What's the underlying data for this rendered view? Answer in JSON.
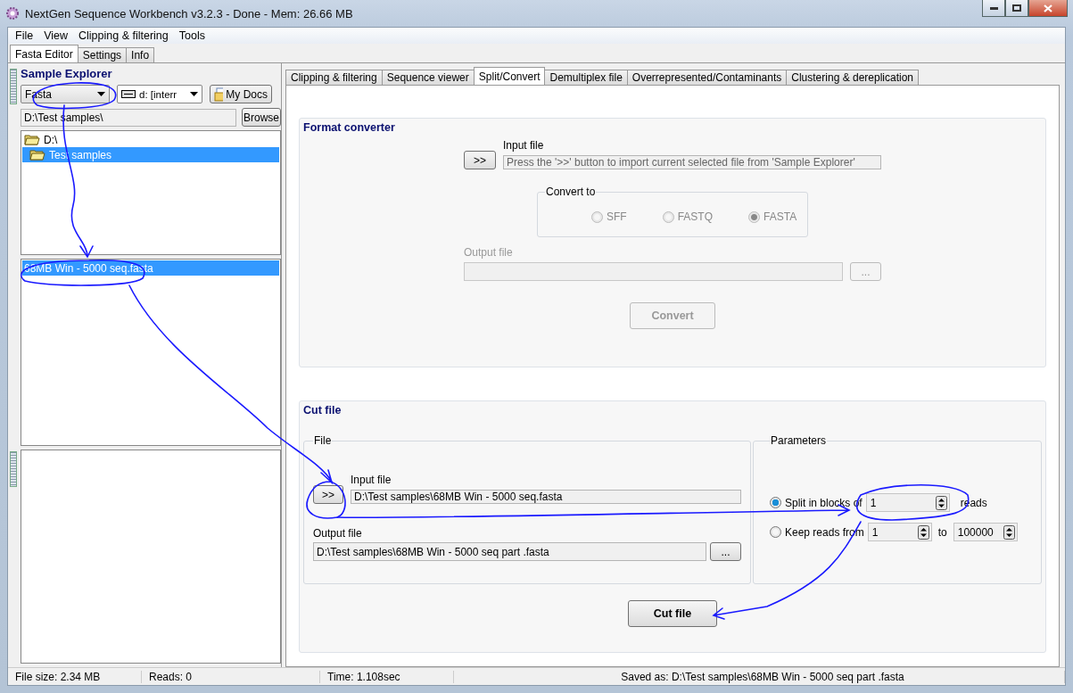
{
  "window": {
    "title": "NextGen Sequence Workbench v3.2.3 - Done -  Mem: 26.66 MB"
  },
  "menu": [
    "File",
    "View",
    "Clipping & filtering",
    "Tools"
  ],
  "main_tabs": [
    {
      "label": "Fasta Editor",
      "selected": true
    },
    {
      "label": "Settings",
      "selected": false
    },
    {
      "label": "Info",
      "selected": false
    }
  ],
  "sample_explorer": {
    "title": "Sample Explorer",
    "format_combo": "Fasta",
    "drive_combo": "d: [interr",
    "my_docs_button": "My Docs",
    "path": "D:\\Test samples\\",
    "browse_button": "Browse",
    "folders": [
      {
        "label": "D:\\",
        "selected": false,
        "children": [
          {
            "label": "Test samples",
            "selected": true
          }
        ]
      }
    ],
    "files": [
      {
        "label": "68MB Win - 5000 seq.fasta",
        "selected": true
      }
    ]
  },
  "tool_tabs": [
    {
      "label": "Clipping & filtering",
      "selected": false
    },
    {
      "label": "Sequence viewer",
      "selected": false
    },
    {
      "label": "Split/Convert",
      "selected": true
    },
    {
      "label": "Demultiplex file",
      "selected": false
    },
    {
      "label": "Overrepresented/Contaminants",
      "selected": false
    },
    {
      "label": "Clustering & dereplication",
      "selected": false
    }
  ],
  "format_converter": {
    "title": "Format converter",
    "import_button": ">>",
    "input_label": "Input file",
    "input_value": "Press the '>>' button to import current selected file from 'Sample Explorer'",
    "convert_to": {
      "label": "Convert to",
      "options": [
        {
          "label": "SFF",
          "selected": false
        },
        {
          "label": "FASTQ",
          "selected": false
        },
        {
          "label": "FASTA",
          "selected": true
        }
      ]
    },
    "output_label": "Output file",
    "output_browse": "...",
    "convert_button": "Convert",
    "disabled": true
  },
  "cut_file": {
    "title": "Cut file",
    "file_group": "File",
    "import_button": ">>",
    "input_label": "Input file",
    "input_value": "D:\\Test samples\\68MB Win - 5000 seq.fasta",
    "output_label": "Output file",
    "output_value": "D:\\Test samples\\68MB Win - 5000 seq part .fasta",
    "output_browse": "...",
    "parameters_group": "Parameters",
    "modes": [
      {
        "label": "Split in blocks of",
        "selected": true,
        "fields": [
          {
            "value": "1"
          }
        ],
        "suffix": "reads"
      },
      {
        "label": "Keep reads from",
        "selected": false,
        "fields": [
          {
            "value": "1"
          },
          {
            "value": "100000"
          }
        ],
        "joiner": "to"
      }
    ],
    "cut_button": "Cut file"
  },
  "status_bar": [
    "File size: 2.34 MB",
    "Reads: 0",
    "Time: 1.108sec",
    "Saved as: D:\\Test samples\\68MB Win - 5000 seq part .fasta"
  ]
}
